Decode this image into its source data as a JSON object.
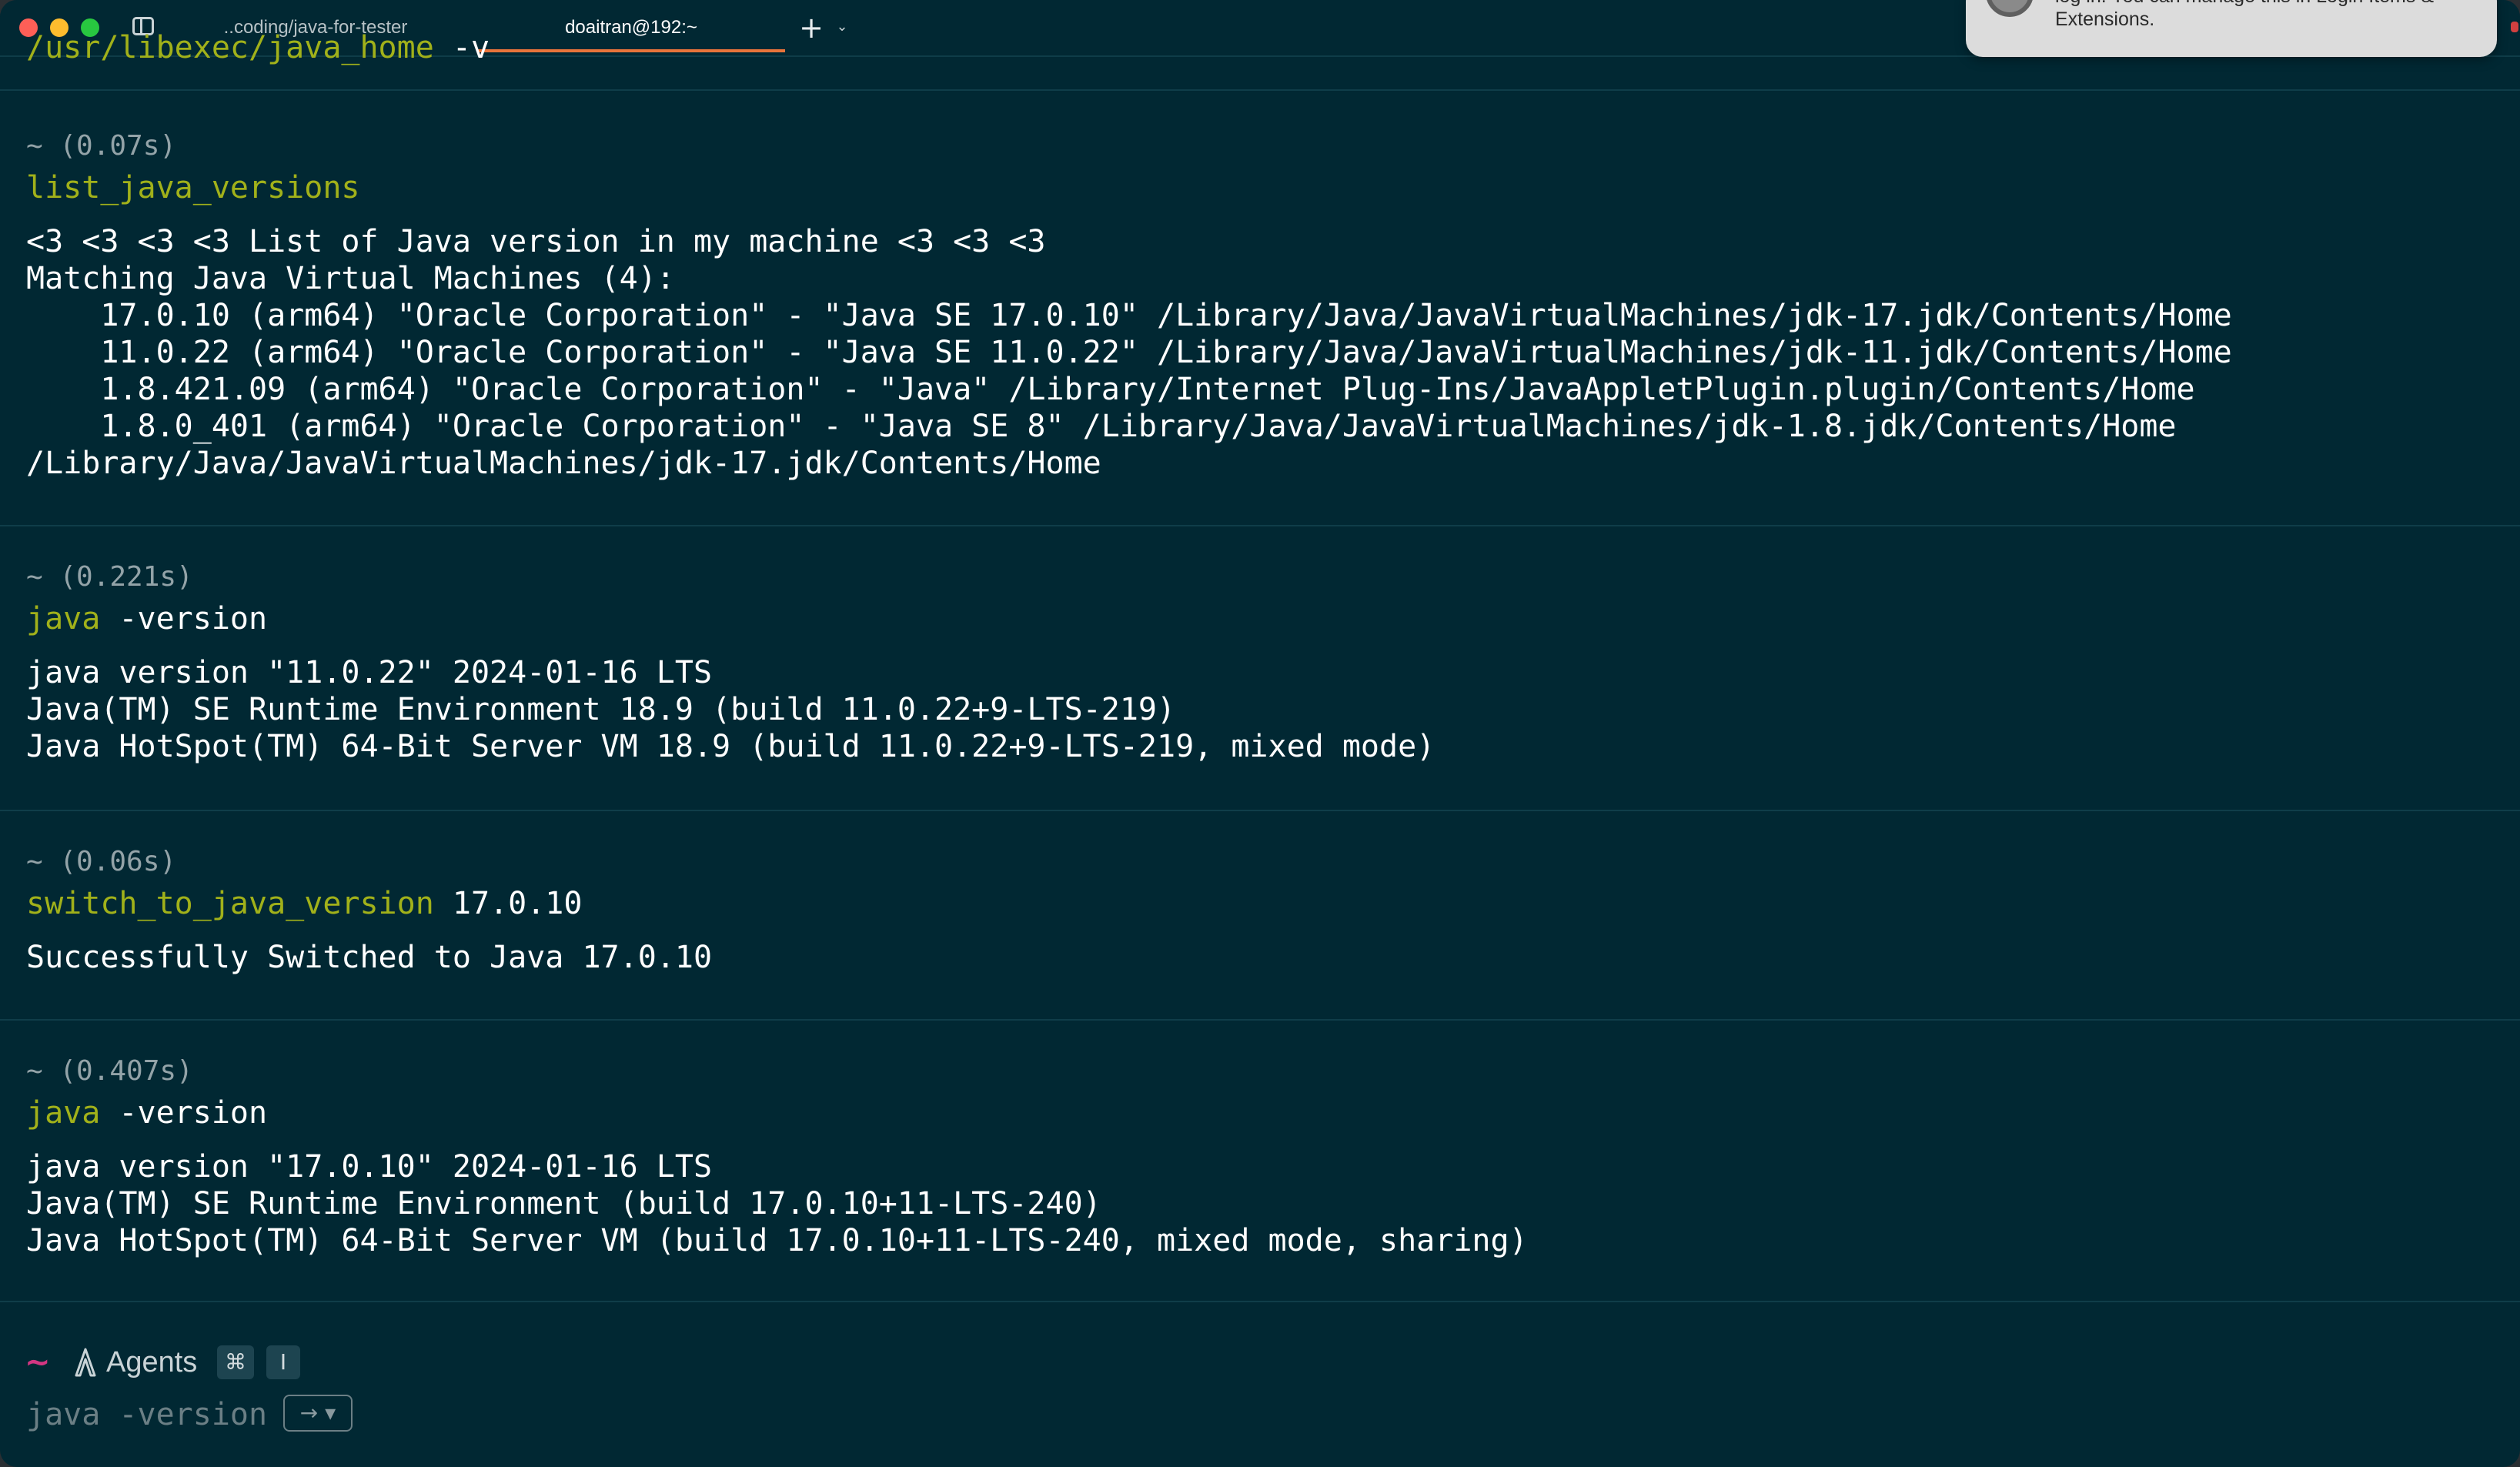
{
  "titlebar": {
    "tabs": [
      {
        "label": "..coding/java-for-tester"
      },
      {
        "label": "doaitran@192:~"
      }
    ],
    "new_tab_symbol": "+",
    "tab_menu_symbol": "⌄"
  },
  "notification": {
    "line1": "log in. You can manage this in Login Items &",
    "line2": "Extensions."
  },
  "terminal": {
    "previous_command": "/usr/libexec/java_home",
    "previous_arg": " -v",
    "blocks": [
      {
        "meta": "~ (0.07s)",
        "command": "list_java_versions",
        "args": "",
        "output": [
          "<3 <3 <3 <3 List of Java version in my machine <3 <3 <3",
          "Matching Java Virtual Machines (4):",
          "    17.0.10 (arm64) \"Oracle Corporation\" - \"Java SE 17.0.10\" /Library/Java/JavaVirtualMachines/jdk-17.jdk/Contents/Home",
          "    11.0.22 (arm64) \"Oracle Corporation\" - \"Java SE 11.0.22\" /Library/Java/JavaVirtualMachines/jdk-11.jdk/Contents/Home",
          "    1.8.421.09 (arm64) \"Oracle Corporation\" - \"Java\" /Library/Internet Plug-Ins/JavaAppletPlugin.plugin/Contents/Home",
          "    1.8.0_401 (arm64) \"Oracle Corporation\" - \"Java SE 8\" /Library/Java/JavaVirtualMachines/jdk-1.8.jdk/Contents/Home",
          "/Library/Java/JavaVirtualMachines/jdk-17.jdk/Contents/Home"
        ]
      },
      {
        "meta": "~ (0.221s)",
        "command": "java",
        "args": " -version",
        "output": [
          "java version \"11.0.22\" 2024-01-16 LTS",
          "Java(TM) SE Runtime Environment 18.9 (build 11.0.22+9-LTS-219)",
          "Java HotSpot(TM) 64-Bit Server VM 18.9 (build 11.0.22+9-LTS-219, mixed mode)"
        ]
      },
      {
        "meta": "~ (0.06s)",
        "command": "switch_to_java_version",
        "args": " 17.0.10",
        "output": [
          "Successfully Switched to Java 17.0.10"
        ]
      },
      {
        "meta": "~ (0.407s)",
        "command": "java",
        "args": " -version",
        "output": [
          "java version \"17.0.10\" 2024-01-16 LTS",
          "Java(TM) SE Runtime Environment (build 17.0.10+11-LTS-240)",
          "Java HotSpot(TM) 64-Bit Server VM (build 17.0.10+11-LTS-240, mixed mode, sharing)"
        ]
      }
    ]
  },
  "input": {
    "prompt": "~",
    "agents_label": "Agents",
    "shortcut_key1": "⌘",
    "shortcut_key2": "I",
    "suggestion": "java -version",
    "accept_label": "→ ▾"
  },
  "colors": {
    "background": "#012833",
    "command": "#a1b11a",
    "prompt": "#d33682",
    "tab_accent": "#e8743b"
  },
  "icons": {
    "agents": "agents-icon",
    "sidebar": "sidebar-toggle-icon"
  }
}
